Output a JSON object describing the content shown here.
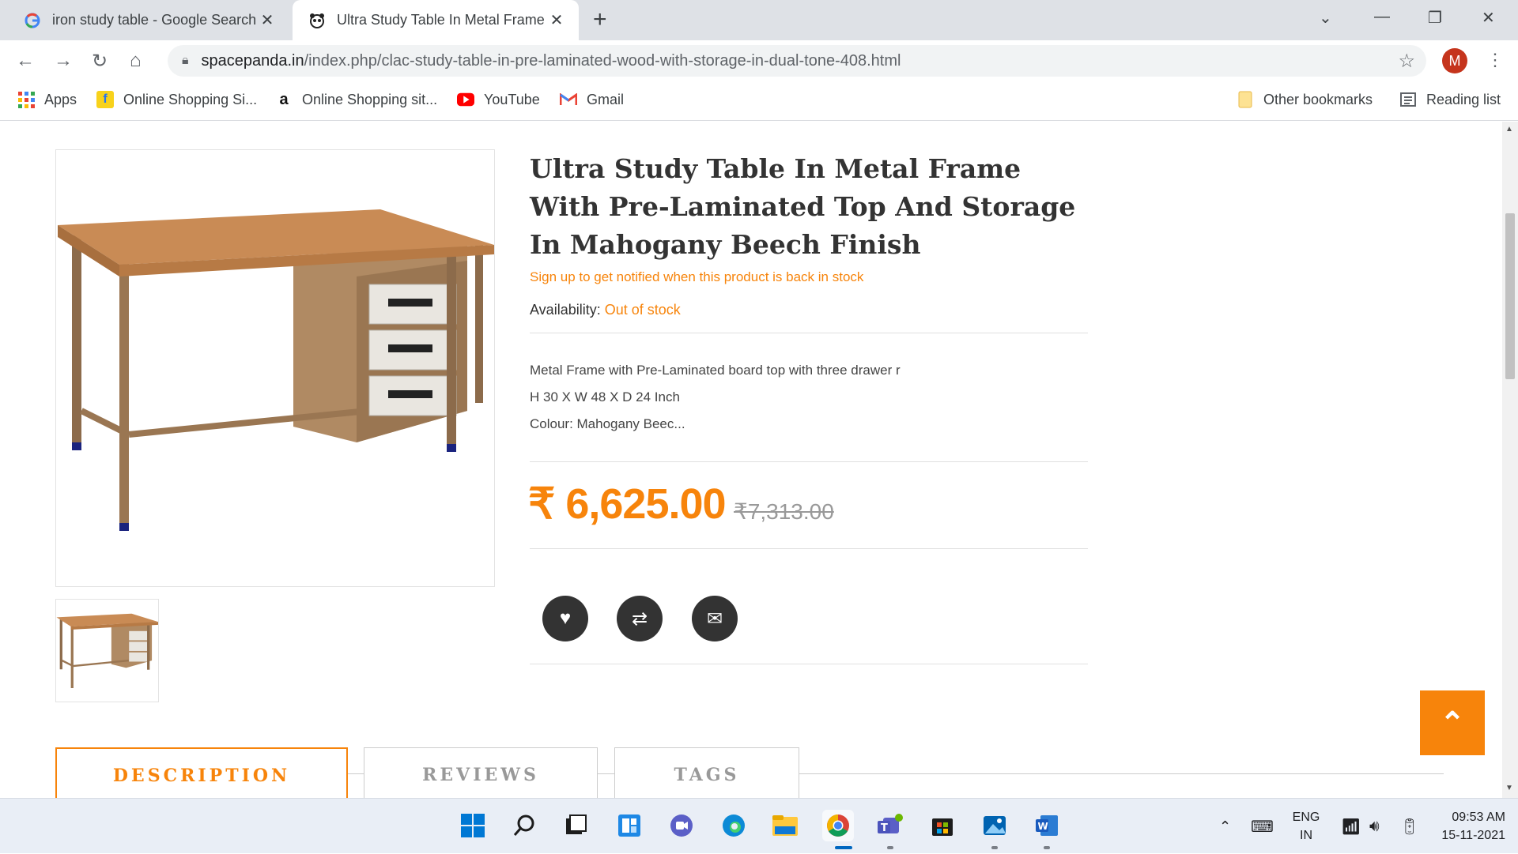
{
  "browser": {
    "tabs": [
      {
        "title": "iron study table - Google Search",
        "active": false
      },
      {
        "title": "Ultra Study Table In Metal Frame",
        "active": true
      }
    ],
    "url_domain": "spacepanda.in",
    "url_path": "/index.php/clac-study-table-in-pre-laminated-wood-with-storage-in-dual-tone-408.html",
    "profile_initial": "M",
    "bookmarks": [
      {
        "label": "Apps"
      },
      {
        "label": "Online Shopping Si..."
      },
      {
        "label": "Online Shopping sit..."
      },
      {
        "label": "YouTube"
      },
      {
        "label": "Gmail"
      }
    ],
    "other_bookmarks": "Other bookmarks",
    "reading_list": "Reading list"
  },
  "product": {
    "title": "Ultra Study Table In Metal Frame With Pre-Laminated Top And Storage In Mahogany Beech Finish",
    "notify": "Sign up to get notified when this product is back in stock",
    "availability_label": "Availability:",
    "availability_value": "Out of stock",
    "desc_lines": [
      "Metal Frame with Pre-Laminated board top with three drawer r",
      "H 30 X W 48 X D 24 Inch",
      "Colour: Mahogany Beec..."
    ],
    "price": "₹ 6,625.00",
    "old_price": "₹7,313.00",
    "tabs": [
      "DESCRIPTION",
      "REVIEWS",
      "TAGS"
    ]
  },
  "taskbar": {
    "lang_line1": "ENG",
    "lang_line2": "IN",
    "time": "09:53 AM",
    "date": "15-11-2021"
  },
  "colors": {
    "accent": "#f7840b",
    "icon_dark": "#333333"
  }
}
